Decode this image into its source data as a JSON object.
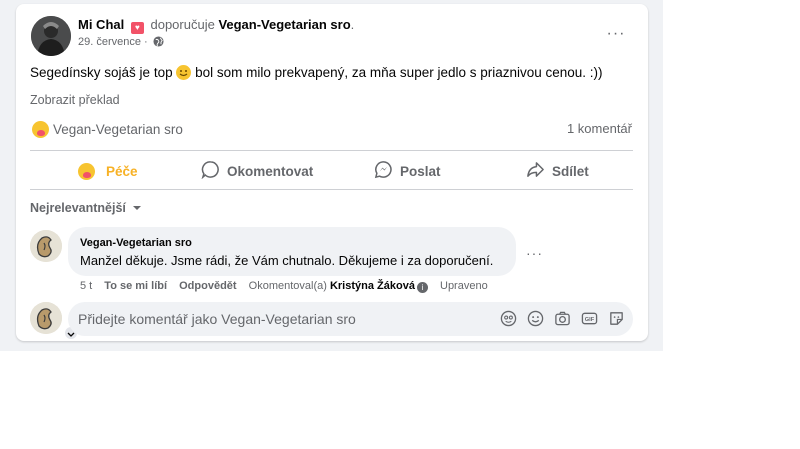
{
  "post": {
    "author": "Mi Chal",
    "verb": "doporučuje",
    "page": "Vegan-Vegetarian sro",
    "date": "29. července",
    "date_sep": " · ",
    "text_before": "Segedínsky sojáš je top ",
    "text_after": " bol som milo prekvapený, za mňa super jedlo s priaznivou cenou. :))",
    "translate": "Zobrazit překlad",
    "more": "···"
  },
  "reactions": {
    "reactor": "Vegan-Vegetarian sro",
    "comment_count": "1 komentář"
  },
  "actions": {
    "care": "Péče",
    "comment": "Okomentovat",
    "send": "Poslat",
    "share": "Sdílet"
  },
  "sort": {
    "label": "Nejrelevantnější"
  },
  "comment": {
    "author": "Vegan-Vegetarian sro",
    "text": "Manžel děkuje. Jsme rádi, že Vám chutnalo. Děkujeme i za doporučení.",
    "time": "5 t",
    "like": "To se mi líbí",
    "reply": "Odpovědět",
    "commented_by_prefix": "Okomentoval(a) ",
    "commented_by_name": "Kristýna Žáková",
    "edited": "Upraveno",
    "more": "···"
  },
  "compose": {
    "placeholder": "Přidejte komentář jako Vegan-Vegetarian sro"
  },
  "colors": {
    "background": "#f0f2f5",
    "care_accent": "#f7b125",
    "secondary_text": "#65676b"
  }
}
